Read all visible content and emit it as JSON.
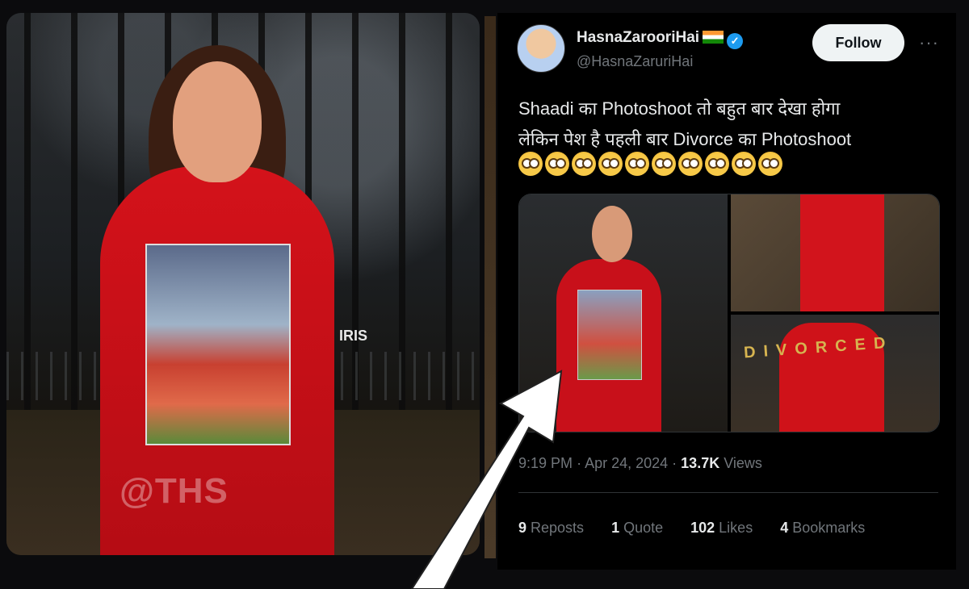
{
  "left_image": {
    "watermark": "@THS",
    "studio_mark": "IRIS"
  },
  "tweet": {
    "display_name": "HasnaZarooriHai",
    "handle": "@HasnaZaruriHai",
    "follow_label": "Follow",
    "more_label": "···",
    "text_line1": "Shaadi का Photoshoot तो बहुत बार देखा होगा",
    "text_line2": "लेकिन पेश है पहली बार Divorce का Photoshoot",
    "emoji_count": 10,
    "media_banner": "DIVORCED",
    "time": "9:19 PM",
    "date": "Apr 24, 2024",
    "views_count": "13.7K",
    "views_label": "Views",
    "stats": [
      {
        "count": "9",
        "label": "Reposts"
      },
      {
        "count": "1",
        "label": "Quote"
      },
      {
        "count": "102",
        "label": "Likes"
      },
      {
        "count": "4",
        "label": "Bookmarks"
      }
    ]
  },
  "colors": {
    "background": "#000000",
    "text": "#e7e9ea",
    "muted": "#71767b",
    "verified": "#1d9bf0",
    "dress_red": "#c8101a"
  },
  "icons": [
    "verified-badge-icon",
    "more-options-icon",
    "flag-india-icon",
    "flushed-face-emoji-icon",
    "white-arrow-icon"
  ]
}
